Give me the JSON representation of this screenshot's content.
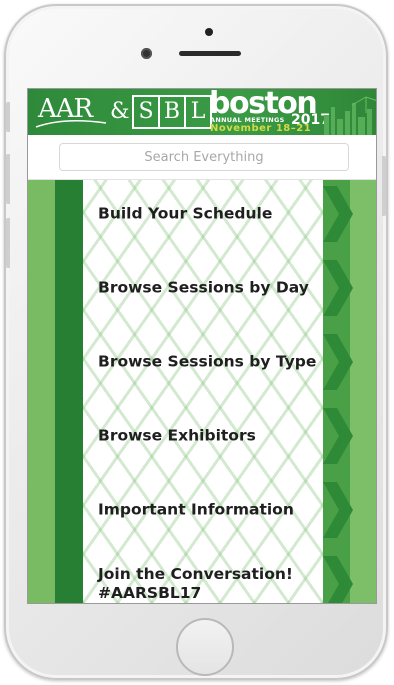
{
  "header": {
    "aar_logo": "AAR",
    "ampersand": "&",
    "sbl_letters": [
      "S",
      "B",
      "L"
    ],
    "city": "boston",
    "event_line": "ANNUAL MEETINGS",
    "year": "2017",
    "dates": "November 18–21"
  },
  "search": {
    "placeholder": "Search Everything",
    "value": ""
  },
  "menu": {
    "items": [
      {
        "label": "Build Your Schedule"
      },
      {
        "label": "Browse Sessions by Day"
      },
      {
        "label": "Browse Sessions by Type"
      },
      {
        "label": "Browse Exhibitors"
      },
      {
        "label": "Important Information"
      },
      {
        "label": "Join the Conversation!",
        "label2": "#AARSBL17"
      }
    ]
  },
  "colors": {
    "header_green": "#3a9b45",
    "band_dark": "#277f34",
    "band_light": "#79bb63",
    "chevron_green": "#2f8a38",
    "dates_yellow": "#d4d946"
  },
  "icons": {
    "menu_arrow": "chevron-right-icon",
    "skyline": "boston-skyline-icon"
  }
}
